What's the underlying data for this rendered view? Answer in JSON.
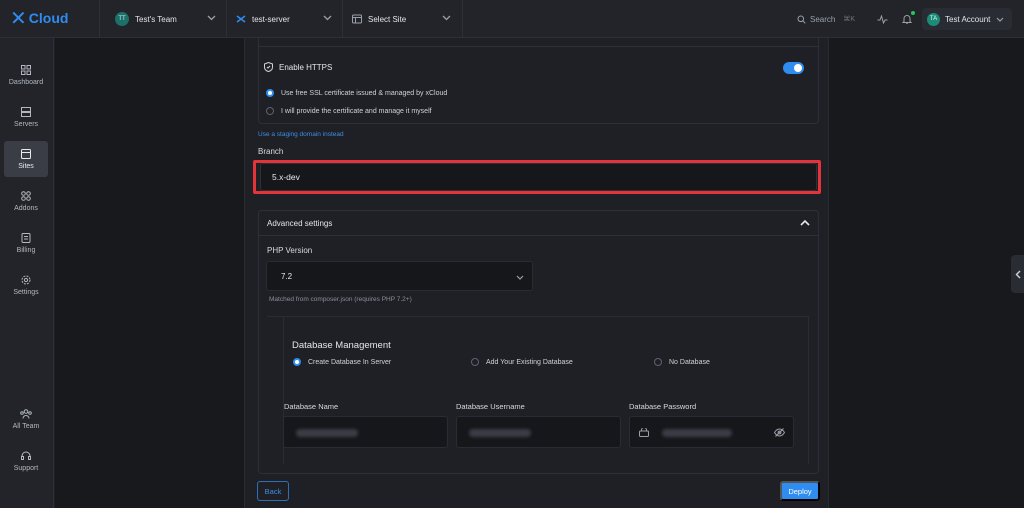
{
  "app": {
    "logo_text": "Cloud"
  },
  "topbar": {
    "team": {
      "initials": "TT",
      "label": "Test's Team"
    },
    "server": {
      "label": "test-server"
    },
    "site": {
      "label": "Select Site"
    },
    "search": {
      "label": "Search",
      "shortcut": "⌘K"
    },
    "account": {
      "initials": "TA",
      "label": "Test Account"
    }
  },
  "sidebar": {
    "items": [
      {
        "label": "Dashboard",
        "icon": "dashboard-icon"
      },
      {
        "label": "Servers",
        "icon": "servers-icon"
      },
      {
        "label": "Sites",
        "icon": "sites-icon",
        "active": true
      },
      {
        "label": "Addons",
        "icon": "addons-icon"
      },
      {
        "label": "Billing",
        "icon": "billing-icon"
      },
      {
        "label": "Settings",
        "icon": "gear-icon"
      }
    ],
    "bottom": [
      {
        "label": "All Team",
        "icon": "team-icon"
      },
      {
        "label": "Support",
        "icon": "headset-icon"
      }
    ]
  },
  "form": {
    "https": {
      "label": "Enable HTTPS",
      "enabled": true,
      "options": [
        {
          "label": "Use free SSL certificate issued & managed by xCloud",
          "selected": true
        },
        {
          "label": "I will provide the certificate and manage it myself",
          "selected": false
        }
      ]
    },
    "staging_link": "Use a staging domain instead",
    "branch": {
      "label": "Branch",
      "value": "5.x-dev"
    },
    "advanced": {
      "title": "Advanced settings",
      "php": {
        "label": "PHP Version",
        "value": "7.2",
        "hint": "Matched from composer.json (requires PHP 7.2+)"
      },
      "database": {
        "title": "Database Management",
        "options": [
          {
            "label": "Create Database In Server",
            "selected": true
          },
          {
            "label": "Add Your Existing Database",
            "selected": false
          },
          {
            "label": "No Database",
            "selected": false
          }
        ],
        "fields": {
          "name_label": "Database Name",
          "username_label": "Database Username",
          "password_label": "Database Password"
        }
      }
    },
    "buttons": {
      "back": "Back",
      "deploy": "Deploy"
    }
  },
  "colors": {
    "accent": "#2f8cf0",
    "highlight": "#e5333a",
    "success_dot": "#22c55e"
  }
}
